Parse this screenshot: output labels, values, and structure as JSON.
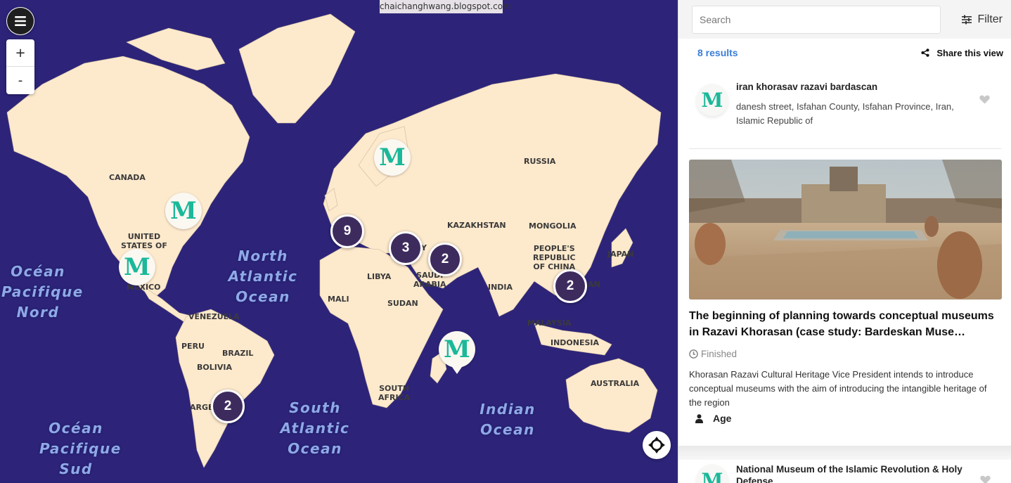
{
  "map": {
    "attribution": "chaichanghwang.blogspot.com",
    "menu_icon": "hamburger-menu-icon",
    "zoom_in": "+",
    "zoom_out": "-",
    "oceans": {
      "north_pacific": "Océan\nPacifique\nNord",
      "north_atlantic": "North\nAtlantic\nOcean",
      "south_atlantic": "South\nAtlantic\nOcean",
      "indian": "Indian\nOcean",
      "south_pacific": "Océan\nPacifique\nSud"
    },
    "countries": {
      "canada": "CANADA",
      "usa": "UNITED\nSTATES OF",
      "mexico": "MEXICO",
      "venezuela": "VENEZUELA",
      "peru": "PERU",
      "brazil": "BRAZIL",
      "bolivia": "BOLIVIA",
      "argentina": "ARGE",
      "russia": "RUSSIA",
      "kazakhstan": "KAZAKHSTAN",
      "mongolia": "MONGOLIA",
      "china": "PEOPLE'S\nREPUBLIC\nOF CHINA",
      "japan": "JAPAN",
      "libya": "LIBYA",
      "saudi": "SAUDI\nARABIA",
      "india": "INDIA",
      "mali": "MALI",
      "sudan": "SUDAN",
      "malaysia": "MALAYSIA",
      "indonesia": "INDONESIA",
      "south_africa": "SOUTH\nAFRICA",
      "australia": "AUSTRALIA",
      "turkey_partial": "Y",
      "taiwan_partial": "AN"
    },
    "clusters": {
      "europe": "9",
      "turkey": "3",
      "gulf": "2",
      "east_asia": "2",
      "south_america": "2"
    },
    "marker_logo": "M"
  },
  "panel": {
    "search_placeholder": "Search",
    "filter_label": "Filter",
    "results": "8 results",
    "share_label": "Share this view",
    "item1": {
      "title": "iran khorasav razavi bardascan",
      "address": "danesh street, Isfahan County, Isfahan Province, Iran, Islamic Republic of"
    },
    "card": {
      "title": "The beginning of planning towards conceptual museums in Razavi Khorasan (case study: Bardeskan Muse…",
      "status": "Finished",
      "description": "Khorasan Razavi Cultural Heritage Vice President intends to introduce conceptual museums with the aim of introducing the intangible heritage of the region",
      "tag": "Age"
    },
    "item2": {
      "title": "National Museum of the Islamic Revolution & Holy Defense"
    }
  },
  "colors": {
    "ocean": "#2d2479",
    "land": "#fde9cc",
    "cluster": "#3e2b5e",
    "logo": "#1bb899",
    "results": "#3b7dd8"
  }
}
